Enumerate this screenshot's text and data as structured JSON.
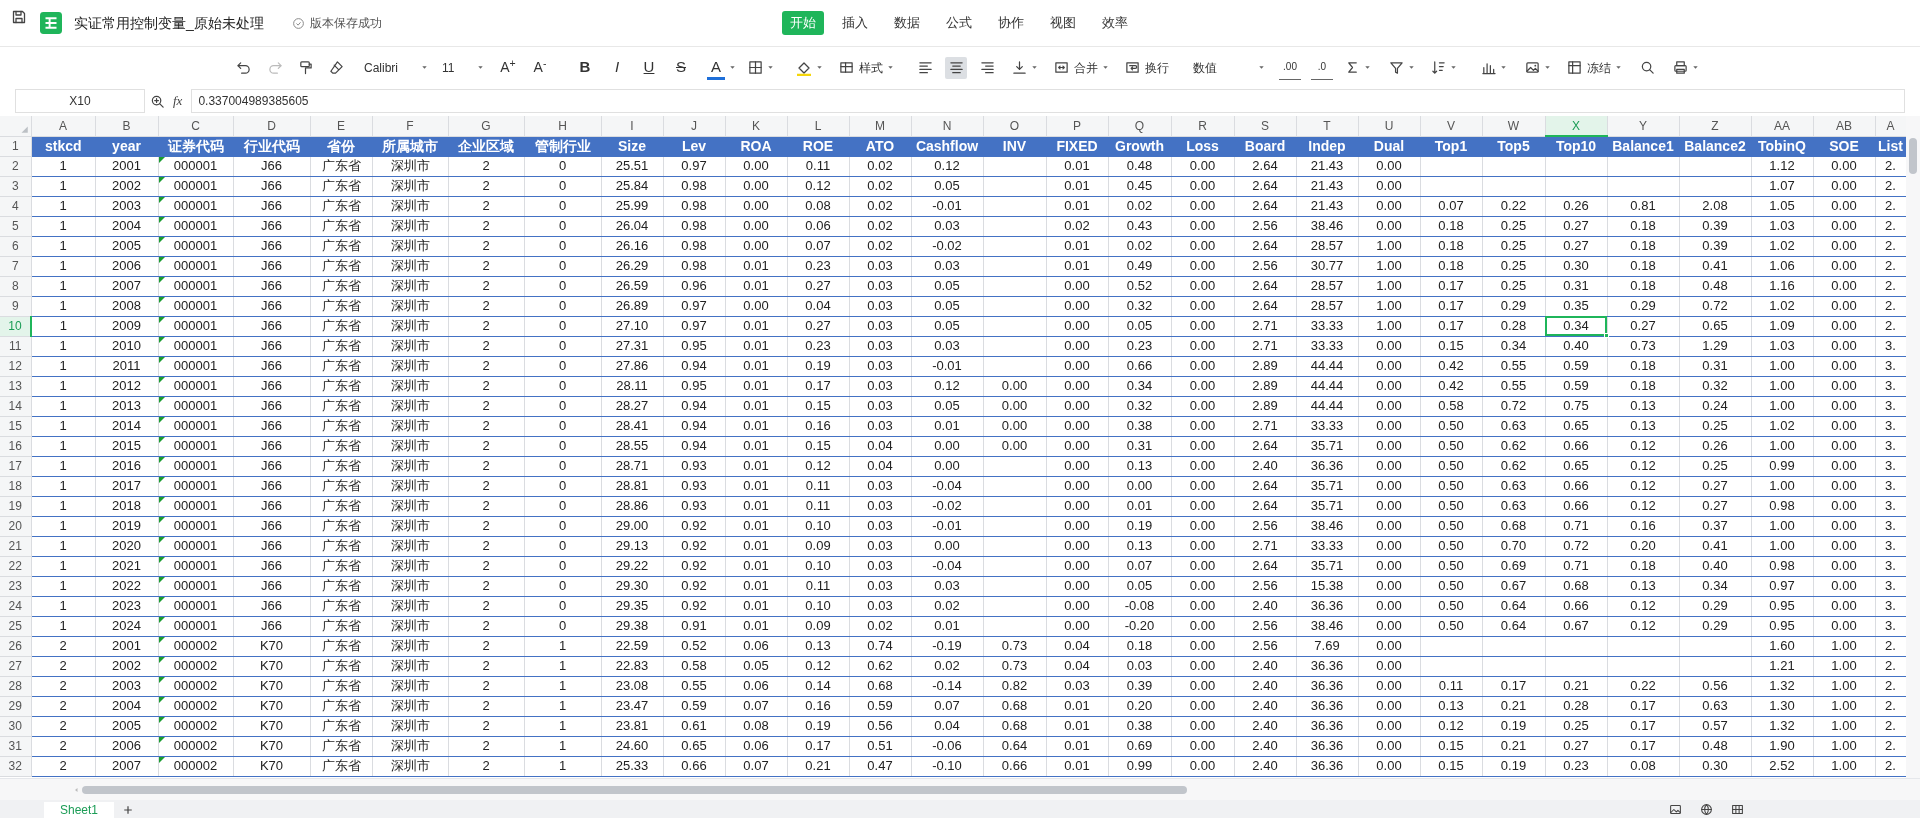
{
  "app_bar": {
    "title": "实证常用控制变量_原始未处理",
    "save_status": "版本保存成功"
  },
  "menu_tabs": [
    {
      "label": "开始",
      "selected": true
    },
    {
      "label": "插入",
      "selected": false
    },
    {
      "label": "数据",
      "selected": false
    },
    {
      "label": "公式",
      "selected": false
    },
    {
      "label": "协作",
      "selected": false
    },
    {
      "label": "视图",
      "selected": false
    },
    {
      "label": "效率",
      "selected": false
    }
  ],
  "toolbar": {
    "font": "Calibri",
    "font_size": "11",
    "grow_font": "A$^{+}$",
    "shrink_font": "A$^{-}$",
    "text_styles": [
      {
        "label": "B"
      },
      {
        "label": "I"
      },
      {
        "label": "U"
      },
      {
        "label": "S"
      }
    ],
    "font_color": "A",
    "style_menu": "样式",
    "alignment": [
      {
        "selected": false
      },
      {
        "selected": true
      },
      {
        "selected": false
      }
    ],
    "merge": "合并",
    "wrap": "换行",
    "number_format": "数值",
    "decimal_buttons": [
      ".00",
      ".0"
    ],
    "freeze": "冻结"
  },
  "formula_bar": {
    "name_box": "X10",
    "function_label": "fx",
    "formula": "0.337004989385605"
  },
  "sheet": {
    "header_row_number": "1",
    "columns": [
      {
        "letter": "A",
        "header": "stkcd",
        "selected": false,
        "text_flag": false
      },
      {
        "letter": "B",
        "header": "year",
        "selected": false,
        "text_flag": false
      },
      {
        "letter": "C",
        "header": "证券代码",
        "selected": false,
        "text_flag": true
      },
      {
        "letter": "D",
        "header": "行业代码",
        "selected": false,
        "text_flag": false
      },
      {
        "letter": "E",
        "header": "省份",
        "selected": false,
        "text_flag": false
      },
      {
        "letter": "F",
        "header": "所属城市",
        "selected": false,
        "text_flag": false
      },
      {
        "letter": "G",
        "header": "企业区域",
        "selected": false,
        "text_flag": false
      },
      {
        "letter": "H",
        "header": "管制行业",
        "selected": false,
        "text_flag": false
      },
      {
        "letter": "I",
        "header": "Size",
        "selected": false,
        "text_flag": false
      },
      {
        "letter": "J",
        "header": "Lev",
        "selected": false,
        "text_flag": false
      },
      {
        "letter": "K",
        "header": "ROA",
        "selected": false,
        "text_flag": false
      },
      {
        "letter": "L",
        "header": "ROE",
        "selected": false,
        "text_flag": false
      },
      {
        "letter": "M",
        "header": "ATO",
        "selected": false,
        "text_flag": false
      },
      {
        "letter": "N",
        "header": "Cashflow",
        "selected": false,
        "text_flag": false
      },
      {
        "letter": "O",
        "header": "INV",
        "selected": false,
        "text_flag": false
      },
      {
        "letter": "P",
        "header": "FIXED",
        "selected": false,
        "text_flag": false
      },
      {
        "letter": "Q",
        "header": "Growth",
        "selected": false,
        "text_flag": false
      },
      {
        "letter": "R",
        "header": "Loss",
        "selected": false,
        "text_flag": false
      },
      {
        "letter": "S",
        "header": "Board",
        "selected": false,
        "text_flag": false
      },
      {
        "letter": "T",
        "header": "Indep",
        "selected": false,
        "text_flag": false
      },
      {
        "letter": "U",
        "header": "Dual",
        "selected": false,
        "text_flag": false
      },
      {
        "letter": "V",
        "header": "Top1",
        "selected": false,
        "text_flag": false
      },
      {
        "letter": "W",
        "header": "Top5",
        "selected": false,
        "text_flag": false
      },
      {
        "letter": "X",
        "header": "Top10",
        "selected": true,
        "text_flag": false
      },
      {
        "letter": "Y",
        "header": "Balance1",
        "selected": false,
        "text_flag": false
      },
      {
        "letter": "Z",
        "header": "Balance2",
        "selected": false,
        "text_flag": false
      },
      {
        "letter": "AA",
        "header": "TobinQ",
        "selected": false,
        "text_flag": false
      },
      {
        "letter": "AB",
        "header": "SOE",
        "selected": false,
        "text_flag": false
      },
      {
        "letter": "A",
        "header": "List",
        "selected": false,
        "text_flag": false
      }
    ],
    "rows": [
      {
        "number": "2",
        "selected": false,
        "cells": [
          "1",
          "2001",
          "000001",
          "J66",
          "广东省",
          "深圳市",
          "2",
          "0",
          "25.51",
          "0.97",
          "0.00",
          "0.11",
          "0.02",
          "0.12",
          null,
          "0.01",
          "0.48",
          "0.00",
          "2.64",
          "21.43",
          "0.00",
          null,
          null,
          null,
          null,
          null,
          "1.12",
          "0.00",
          "2."
        ]
      },
      {
        "number": "3",
        "selected": false,
        "cells": [
          "1",
          "2002",
          "000001",
          "J66",
          "广东省",
          "深圳市",
          "2",
          "0",
          "25.84",
          "0.98",
          "0.00",
          "0.12",
          "0.02",
          "0.05",
          null,
          "0.01",
          "0.45",
          "0.00",
          "2.64",
          "21.43",
          "0.00",
          null,
          null,
          null,
          null,
          null,
          "1.07",
          "0.00",
          "2."
        ]
      },
      {
        "number": "4",
        "selected": false,
        "cells": [
          "1",
          "2003",
          "000001",
          "J66",
          "广东省",
          "深圳市",
          "2",
          "0",
          "25.99",
          "0.98",
          "0.00",
          "0.08",
          "0.02",
          "-0.01",
          null,
          "0.01",
          "0.02",
          "0.00",
          "2.64",
          "21.43",
          "0.00",
          "0.07",
          "0.22",
          "0.26",
          "0.81",
          "2.08",
          "1.05",
          "0.00",
          "2."
        ]
      },
      {
        "number": "5",
        "selected": false,
        "cells": [
          "1",
          "2004",
          "000001",
          "J66",
          "广东省",
          "深圳市",
          "2",
          "0",
          "26.04",
          "0.98",
          "0.00",
          "0.06",
          "0.02",
          "0.03",
          null,
          "0.02",
          "0.43",
          "0.00",
          "2.56",
          "38.46",
          "0.00",
          "0.18",
          "0.25",
          "0.27",
          "0.18",
          "0.39",
          "1.03",
          "0.00",
          "2."
        ]
      },
      {
        "number": "6",
        "selected": false,
        "cells": [
          "1",
          "2005",
          "000001",
          "J66",
          "广东省",
          "深圳市",
          "2",
          "0",
          "26.16",
          "0.98",
          "0.00",
          "0.07",
          "0.02",
          "-0.02",
          null,
          "0.01",
          "0.02",
          "0.00",
          "2.64",
          "28.57",
          "1.00",
          "0.18",
          "0.25",
          "0.27",
          "0.18",
          "0.39",
          "1.02",
          "0.00",
          "2."
        ]
      },
      {
        "number": "7",
        "selected": false,
        "cells": [
          "1",
          "2006",
          "000001",
          "J66",
          "广东省",
          "深圳市",
          "2",
          "0",
          "26.29",
          "0.98",
          "0.01",
          "0.23",
          "0.03",
          "0.03",
          null,
          "0.01",
          "0.49",
          "0.00",
          "2.56",
          "30.77",
          "1.00",
          "0.18",
          "0.25",
          "0.30",
          "0.18",
          "0.41",
          "1.06",
          "0.00",
          "2."
        ]
      },
      {
        "number": "8",
        "selected": false,
        "cells": [
          "1",
          "2007",
          "000001",
          "J66",
          "广东省",
          "深圳市",
          "2",
          "0",
          "26.59",
          "0.96",
          "0.01",
          "0.27",
          "0.03",
          "0.05",
          null,
          "0.00",
          "0.52",
          "0.00",
          "2.64",
          "28.57",
          "1.00",
          "0.17",
          "0.25",
          "0.31",
          "0.18",
          "0.48",
          "1.16",
          "0.00",
          "2."
        ]
      },
      {
        "number": "9",
        "selected": false,
        "cells": [
          "1",
          "2008",
          "000001",
          "J66",
          "广东省",
          "深圳市",
          "2",
          "0",
          "26.89",
          "0.97",
          "0.00",
          "0.04",
          "0.03",
          "0.05",
          null,
          "0.00",
          "0.32",
          "0.00",
          "2.64",
          "28.57",
          "1.00",
          "0.17",
          "0.29",
          "0.35",
          "0.29",
          "0.72",
          "1.02",
          "0.00",
          "2."
        ]
      },
      {
        "number": "10",
        "selected": true,
        "cells": [
          "1",
          "2009",
          "000001",
          "J66",
          "广东省",
          "深圳市",
          "2",
          "0",
          "27.10",
          "0.97",
          "0.01",
          "0.27",
          "0.03",
          "0.05",
          null,
          "0.00",
          "0.05",
          "0.00",
          "2.71",
          "33.33",
          "1.00",
          "0.17",
          "0.28",
          "0.34",
          "0.27",
          "0.65",
          "1.09",
          "0.00",
          "2."
        ]
      },
      {
        "number": "11",
        "selected": false,
        "cells": [
          "1",
          "2010",
          "000001",
          "J66",
          "广东省",
          "深圳市",
          "2",
          "0",
          "27.31",
          "0.95",
          "0.01",
          "0.23",
          "0.03",
          "0.03",
          null,
          "0.00",
          "0.23",
          "0.00",
          "2.71",
          "33.33",
          "0.00",
          "0.15",
          "0.34",
          "0.40",
          "0.73",
          "1.29",
          "1.03",
          "0.00",
          "3."
        ]
      },
      {
        "number": "12",
        "selected": false,
        "cells": [
          "1",
          "2011",
          "000001",
          "J66",
          "广东省",
          "深圳市",
          "2",
          "0",
          "27.86",
          "0.94",
          "0.01",
          "0.19",
          "0.03",
          "-0.01",
          null,
          "0.00",
          "0.66",
          "0.00",
          "2.89",
          "44.44",
          "0.00",
          "0.42",
          "0.55",
          "0.59",
          "0.18",
          "0.31",
          "1.00",
          "0.00",
          "3."
        ]
      },
      {
        "number": "13",
        "selected": false,
        "cells": [
          "1",
          "2012",
          "000001",
          "J66",
          "广东省",
          "深圳市",
          "2",
          "0",
          "28.11",
          "0.95",
          "0.01",
          "0.17",
          "0.03",
          "0.12",
          "0.00",
          "0.00",
          "0.34",
          "0.00",
          "2.89",
          "44.44",
          "0.00",
          "0.42",
          "0.55",
          "0.59",
          "0.18",
          "0.32",
          "1.00",
          "0.00",
          "3."
        ]
      },
      {
        "number": "14",
        "selected": false,
        "cells": [
          "1",
          "2013",
          "000001",
          "J66",
          "广东省",
          "深圳市",
          "2",
          "0",
          "28.27",
          "0.94",
          "0.01",
          "0.15",
          "0.03",
          "0.05",
          "0.00",
          "0.00",
          "0.32",
          "0.00",
          "2.89",
          "44.44",
          "0.00",
          "0.58",
          "0.72",
          "0.75",
          "0.13",
          "0.24",
          "1.00",
          "0.00",
          "3."
        ]
      },
      {
        "number": "15",
        "selected": false,
        "cells": [
          "1",
          "2014",
          "000001",
          "J66",
          "广东省",
          "深圳市",
          "2",
          "0",
          "28.41",
          "0.94",
          "0.01",
          "0.16",
          "0.03",
          "0.01",
          "0.00",
          "0.00",
          "0.38",
          "0.00",
          "2.71",
          "33.33",
          "0.00",
          "0.50",
          "0.63",
          "0.65",
          "0.13",
          "0.25",
          "1.02",
          "0.00",
          "3."
        ]
      },
      {
        "number": "16",
        "selected": false,
        "cells": [
          "1",
          "2015",
          "000001",
          "J66",
          "广东省",
          "深圳市",
          "2",
          "0",
          "28.55",
          "0.94",
          "0.01",
          "0.15",
          "0.04",
          "0.00",
          "0.00",
          "0.00",
          "0.31",
          "0.00",
          "2.64",
          "35.71",
          "0.00",
          "0.50",
          "0.62",
          "0.66",
          "0.12",
          "0.26",
          "1.00",
          "0.00",
          "3."
        ]
      },
      {
        "number": "17",
        "selected": false,
        "cells": [
          "1",
          "2016",
          "000001",
          "J66",
          "广东省",
          "深圳市",
          "2",
          "0",
          "28.71",
          "0.93",
          "0.01",
          "0.12",
          "0.04",
          "0.00",
          null,
          "0.00",
          "0.13",
          "0.00",
          "2.40",
          "36.36",
          "0.00",
          "0.50",
          "0.62",
          "0.65",
          "0.12",
          "0.25",
          "0.99",
          "0.00",
          "3."
        ]
      },
      {
        "number": "18",
        "selected": false,
        "cells": [
          "1",
          "2017",
          "000001",
          "J66",
          "广东省",
          "深圳市",
          "2",
          "0",
          "28.81",
          "0.93",
          "0.01",
          "0.11",
          "0.03",
          "-0.04",
          null,
          "0.00",
          "0.00",
          "0.00",
          "2.64",
          "35.71",
          "0.00",
          "0.50",
          "0.63",
          "0.66",
          "0.12",
          "0.27",
          "1.00",
          "0.00",
          "3."
        ]
      },
      {
        "number": "19",
        "selected": false,
        "cells": [
          "1",
          "2018",
          "000001",
          "J66",
          "广东省",
          "深圳市",
          "2",
          "0",
          "28.86",
          "0.93",
          "0.01",
          "0.11",
          "0.03",
          "-0.02",
          null,
          "0.00",
          "0.01",
          "0.00",
          "2.64",
          "35.71",
          "0.00",
          "0.50",
          "0.63",
          "0.66",
          "0.12",
          "0.27",
          "0.98",
          "0.00",
          "3."
        ]
      },
      {
        "number": "20",
        "selected": false,
        "cells": [
          "1",
          "2019",
          "000001",
          "J66",
          "广东省",
          "深圳市",
          "2",
          "0",
          "29.00",
          "0.92",
          "0.01",
          "0.10",
          "0.03",
          "-0.01",
          null,
          "0.00",
          "0.19",
          "0.00",
          "2.56",
          "38.46",
          "0.00",
          "0.50",
          "0.68",
          "0.71",
          "0.16",
          "0.37",
          "1.00",
          "0.00",
          "3."
        ]
      },
      {
        "number": "21",
        "selected": false,
        "cells": [
          "1",
          "2020",
          "000001",
          "J66",
          "广东省",
          "深圳市",
          "2",
          "0",
          "29.13",
          "0.92",
          "0.01",
          "0.09",
          "0.03",
          "0.00",
          null,
          "0.00",
          "0.13",
          "0.00",
          "2.71",
          "33.33",
          "0.00",
          "0.50",
          "0.70",
          "0.72",
          "0.20",
          "0.41",
          "1.00",
          "0.00",
          "3."
        ]
      },
      {
        "number": "22",
        "selected": false,
        "cells": [
          "1",
          "2021",
          "000001",
          "J66",
          "广东省",
          "深圳市",
          "2",
          "0",
          "29.22",
          "0.92",
          "0.01",
          "0.10",
          "0.03",
          "-0.04",
          null,
          "0.00",
          "0.07",
          "0.00",
          "2.64",
          "35.71",
          "0.00",
          "0.50",
          "0.69",
          "0.71",
          "0.18",
          "0.40",
          "0.98",
          "0.00",
          "3."
        ]
      },
      {
        "number": "23",
        "selected": false,
        "cells": [
          "1",
          "2022",
          "000001",
          "J66",
          "广东省",
          "深圳市",
          "2",
          "0",
          "29.30",
          "0.92",
          "0.01",
          "0.11",
          "0.03",
          "0.03",
          null,
          "0.00",
          "0.05",
          "0.00",
          "2.56",
          "15.38",
          "0.00",
          "0.50",
          "0.67",
          "0.68",
          "0.13",
          "0.34",
          "0.97",
          "0.00",
          "3."
        ]
      },
      {
        "number": "24",
        "selected": false,
        "cells": [
          "1",
          "2023",
          "000001",
          "J66",
          "广东省",
          "深圳市",
          "2",
          "0",
          "29.35",
          "0.92",
          "0.01",
          "0.10",
          "0.03",
          "0.02",
          null,
          "0.00",
          "-0.08",
          "0.00",
          "2.40",
          "36.36",
          "0.00",
          "0.50",
          "0.64",
          "0.66",
          "0.12",
          "0.29",
          "0.95",
          "0.00",
          "3."
        ]
      },
      {
        "number": "25",
        "selected": false,
        "cells": [
          "1",
          "2024",
          "000001",
          "J66",
          "广东省",
          "深圳市",
          "2",
          "0",
          "29.38",
          "0.91",
          "0.01",
          "0.09",
          "0.02",
          "0.01",
          null,
          "0.00",
          "-0.20",
          "0.00",
          "2.56",
          "38.46",
          "0.00",
          "0.50",
          "0.64",
          "0.67",
          "0.12",
          "0.29",
          "0.95",
          "0.00",
          "3."
        ]
      },
      {
        "number": "26",
        "selected": false,
        "cells": [
          "2",
          "2001",
          "000002",
          "K70",
          "广东省",
          "深圳市",
          "2",
          "1",
          "22.59",
          "0.52",
          "0.06",
          "0.13",
          "0.74",
          "-0.19",
          "0.73",
          "0.04",
          "0.18",
          "0.00",
          "2.56",
          "7.69",
          "0.00",
          null,
          null,
          null,
          null,
          null,
          "1.60",
          "1.00",
          "2."
        ]
      },
      {
        "number": "27",
        "selected": false,
        "cells": [
          "2",
          "2002",
          "000002",
          "K70",
          "广东省",
          "深圳市",
          "2",
          "1",
          "22.83",
          "0.58",
          "0.05",
          "0.12",
          "0.62",
          "0.02",
          "0.73",
          "0.04",
          "0.03",
          "0.00",
          "2.40",
          "36.36",
          "0.00",
          null,
          null,
          null,
          null,
          null,
          "1.21",
          "1.00",
          "2."
        ]
      },
      {
        "number": "28",
        "selected": false,
        "cells": [
          "2",
          "2003",
          "000002",
          "K70",
          "广东省",
          "深圳市",
          "2",
          "1",
          "23.08",
          "0.55",
          "0.06",
          "0.14",
          "0.68",
          "-0.14",
          "0.82",
          "0.03",
          "0.39",
          "0.00",
          "2.40",
          "36.36",
          "0.00",
          "0.11",
          "0.17",
          "0.21",
          "0.22",
          "0.56",
          "1.32",
          "1.00",
          "2."
        ]
      },
      {
        "number": "29",
        "selected": false,
        "cells": [
          "2",
          "2004",
          "000002",
          "K70",
          "广东省",
          "深圳市",
          "2",
          "1",
          "23.47",
          "0.59",
          "0.07",
          "0.16",
          "0.59",
          "0.07",
          "0.68",
          "0.01",
          "0.20",
          "0.00",
          "2.40",
          "36.36",
          "0.00",
          "0.13",
          "0.21",
          "0.28",
          "0.17",
          "0.63",
          "1.30",
          "1.00",
          "2."
        ]
      },
      {
        "number": "30",
        "selected": false,
        "cells": [
          "2",
          "2005",
          "000002",
          "K70",
          "广东省",
          "深圳市",
          "2",
          "1",
          "23.81",
          "0.61",
          "0.08",
          "0.19",
          "0.56",
          "0.04",
          "0.68",
          "0.01",
          "0.38",
          "0.00",
          "2.40",
          "36.36",
          "0.00",
          "0.12",
          "0.19",
          "0.25",
          "0.17",
          "0.57",
          "1.32",
          "1.00",
          "2."
        ]
      },
      {
        "number": "31",
        "selected": false,
        "cells": [
          "2",
          "2006",
          "000002",
          "K70",
          "广东省",
          "深圳市",
          "2",
          "1",
          "24.60",
          "0.65",
          "0.06",
          "0.17",
          "0.51",
          "-0.06",
          "0.64",
          "0.01",
          "0.69",
          "0.00",
          "2.40",
          "36.36",
          "0.00",
          "0.15",
          "0.21",
          "0.27",
          "0.17",
          "0.48",
          "1.90",
          "1.00",
          "2."
        ]
      },
      {
        "number": "32",
        "selected": false,
        "cells": [
          "2",
          "2007",
          "000002",
          "K70",
          "广东省",
          "深圳市",
          "2",
          "1",
          "25.33",
          "0.66",
          "0.07",
          "0.21",
          "0.47",
          "-0.10",
          "0.66",
          "0.01",
          "0.99",
          "0.00",
          "2.40",
          "36.36",
          "0.00",
          "0.15",
          "0.19",
          "0.23",
          "0.08",
          "0.30",
          "2.52",
          "1.00",
          "2."
        ]
      }
    ]
  },
  "sheet_tabs": [
    {
      "label": "Sheet1",
      "selected": true
    }
  ]
}
